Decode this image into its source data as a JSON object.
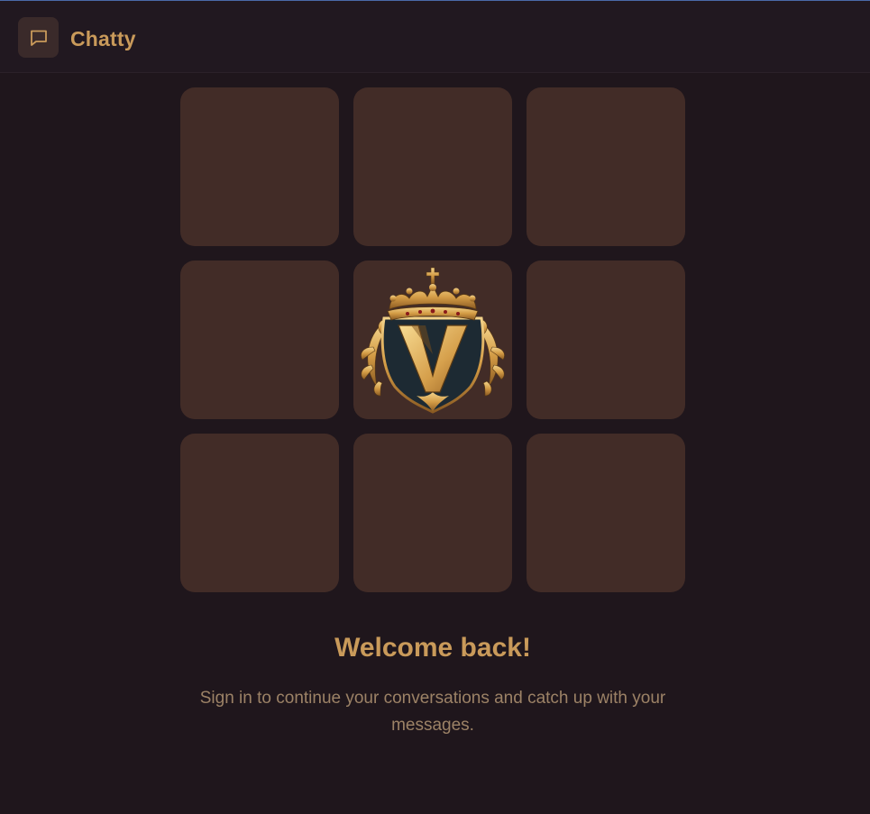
{
  "app": {
    "name": "Chatty",
    "icon": "chat-bubble-icon"
  },
  "grid": {
    "tiles": 9,
    "center_emblem": "crown-v-emblem"
  },
  "auth": {
    "title": "Welcome back!",
    "subtitle": "Sign in to continue your conversations and catch up with your messages."
  },
  "colors": {
    "background": "#1f161c",
    "navbar": "#211820",
    "tile": "#422c27",
    "accent": "#c99a5a",
    "muted_text": "#9c8266"
  }
}
